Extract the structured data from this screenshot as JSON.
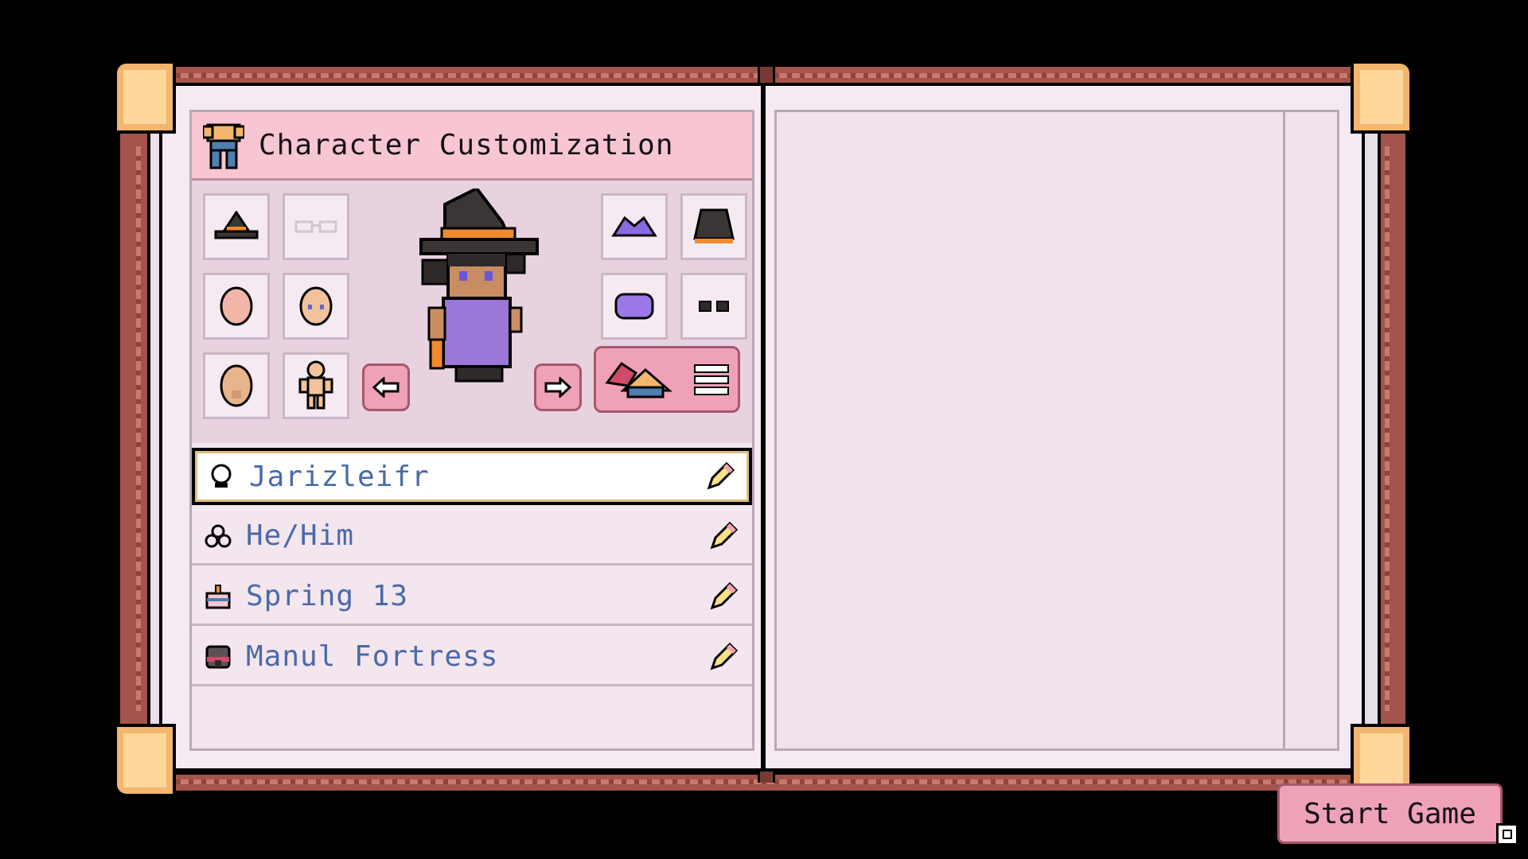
{
  "header": {
    "title": "Character Customization",
    "icon": "shirt-icon"
  },
  "appearance": {
    "left_slots": [
      {
        "name": "hat-slot",
        "icon": "witch-hat-icon"
      },
      {
        "name": "glasses-slot",
        "icon": "glasses-icon"
      },
      {
        "name": "skin-slot",
        "icon": "head-icon"
      },
      {
        "name": "face-slot",
        "icon": "face-icon"
      },
      {
        "name": "head-shape-slot",
        "icon": "bald-head-icon"
      },
      {
        "name": "body-slot",
        "icon": "body-icon"
      }
    ],
    "right_slots": [
      {
        "name": "shirt-slot",
        "icon": "purple-top-icon"
      },
      {
        "name": "pants-slot",
        "icon": "black-skirt-icon"
      },
      {
        "name": "dress-slot",
        "icon": "purple-dress-icon"
      },
      {
        "name": "shoes-slot",
        "icon": "black-shoes-icon"
      }
    ]
  },
  "fields": {
    "name": "Jarizleifr",
    "pronouns": "He/Him",
    "birthday": "Spring 13",
    "farm": "Manul Fortress"
  },
  "start_button": {
    "label": "Start Game"
  },
  "colors": {
    "cover": "#a4544b",
    "page": "#f5eaf2",
    "header": "#f7c6d2",
    "button": "#efa2b7",
    "field_text": "#4a6aa8",
    "accent_gold": "#e2bd7f"
  }
}
